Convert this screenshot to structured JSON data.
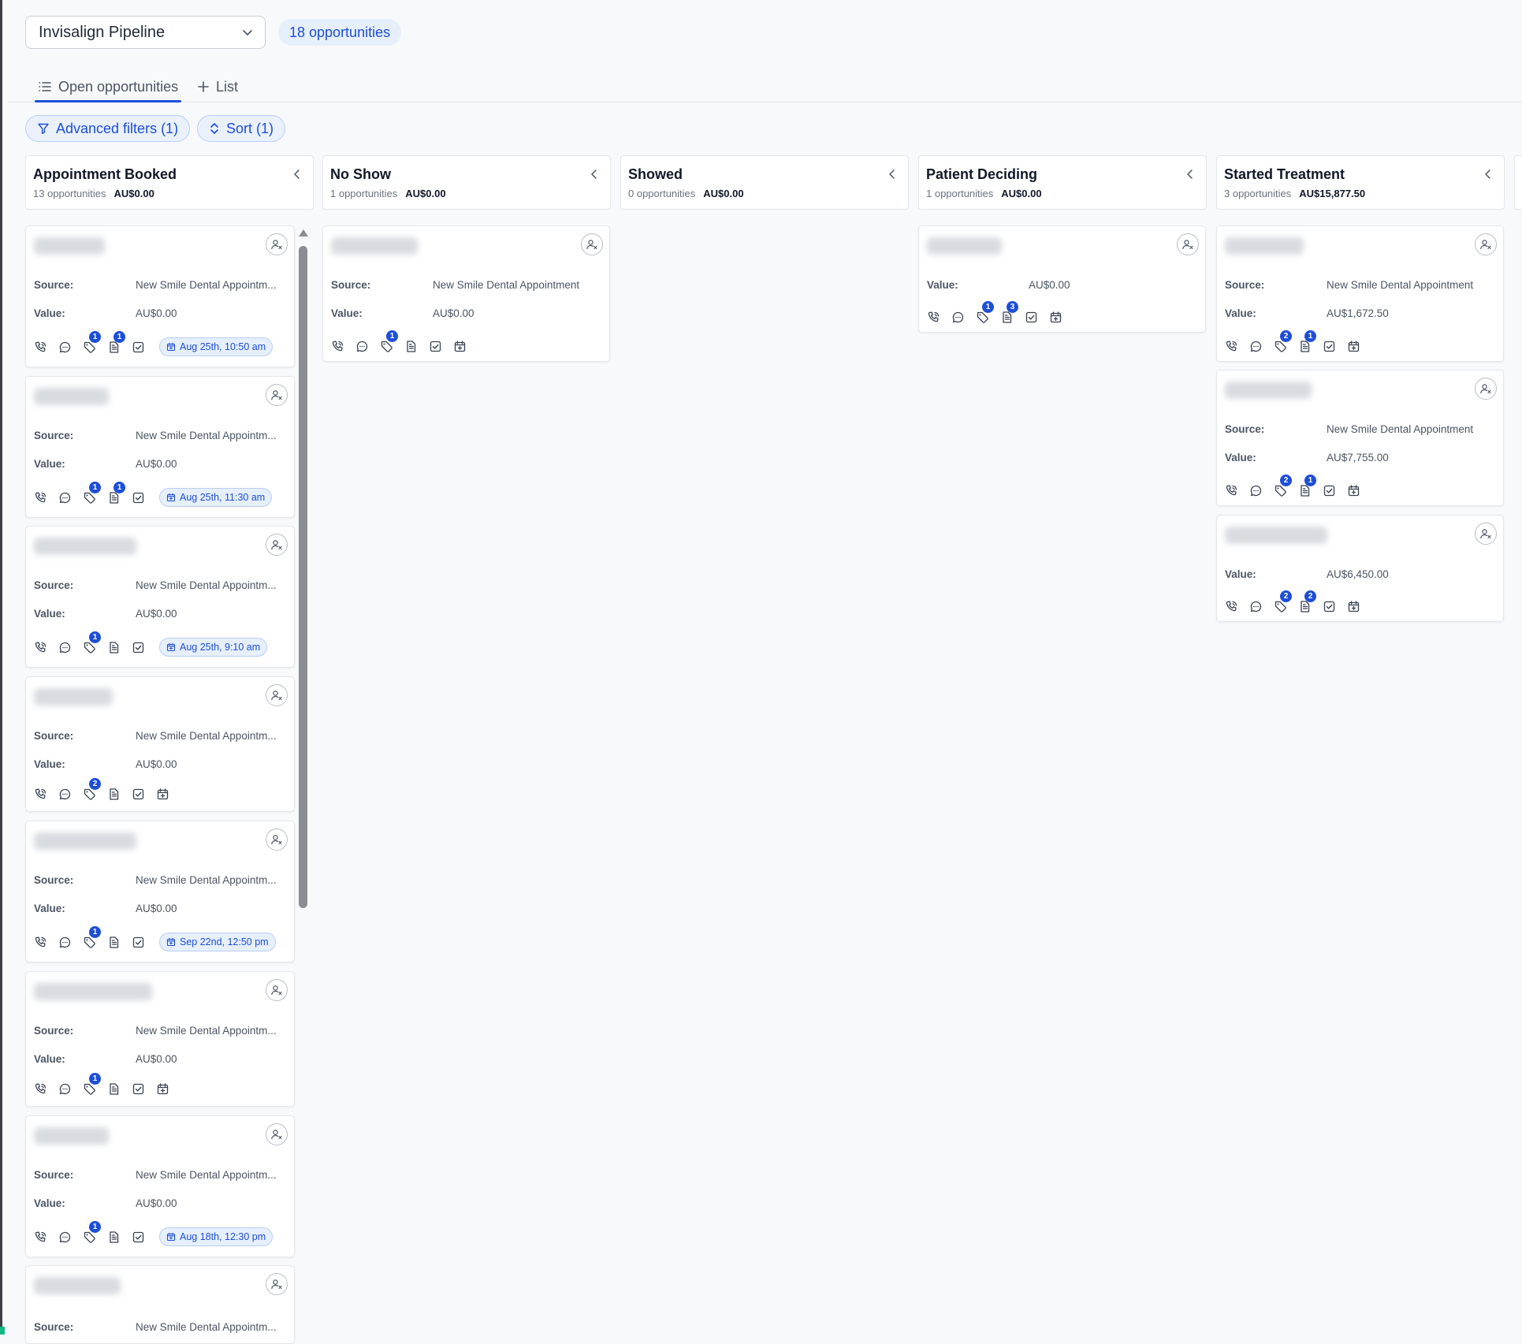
{
  "header": {
    "pipeline_label": "Invisalign Pipeline",
    "opportunity_count": "18 opportunities"
  },
  "tabs": {
    "open": "Open opportunities",
    "list": "List"
  },
  "filters": {
    "advanced": "Advanced filters (1)",
    "sort": "Sort (1)"
  },
  "columns": [
    {
      "title": "Appointment Booked",
      "count": "13 opportunities",
      "amount": "AU$0.00"
    },
    {
      "title": "No Show",
      "count": "1 opportunities",
      "amount": "AU$0.00"
    },
    {
      "title": "Showed",
      "count": "0 opportunities",
      "amount": "AU$0.00"
    },
    {
      "title": "Patient Deciding",
      "count": "1 opportunities",
      "amount": "AU$0.00"
    },
    {
      "title": "Started Treatment",
      "count": "3 opportunities",
      "amount": "AU$15,877.50"
    }
  ],
  "labels": {
    "source": "Source:",
    "value": "Value:"
  },
  "cards": {
    "booked": [
      {
        "source": "New Smile Dental Appointm...",
        "value": "AU$0.00",
        "badges": [
          "",
          "",
          "1",
          "1"
        ],
        "appointment": "Aug 25th, 10:50 am"
      },
      {
        "source": "New Smile Dental Appointm...",
        "value": "AU$0.00",
        "badges": [
          "",
          "",
          "1",
          "1"
        ],
        "appointment": "Aug 25th, 11:30 am"
      },
      {
        "source": "New Smile Dental Appointm...",
        "value": "AU$0.00",
        "badges": [
          "",
          "",
          "1",
          ""
        ],
        "appointment": "Aug 25th, 9:10 am"
      },
      {
        "source": "New Smile Dental Appointm...",
        "value": "AU$0.00",
        "badges": [
          "",
          "",
          "2",
          ""
        ],
        "appointment": ""
      },
      {
        "source": "New Smile Dental Appointm...",
        "value": "AU$0.00",
        "badges": [
          "",
          "",
          "1",
          ""
        ],
        "appointment": "Sep 22nd, 12:50 pm"
      },
      {
        "source": "New Smile Dental Appointm...",
        "value": "AU$0.00",
        "badges": [
          "",
          "",
          "1",
          ""
        ],
        "appointment": ""
      },
      {
        "source": "New Smile Dental Appointm...",
        "value": "AU$0.00",
        "badges": [
          "",
          "",
          "1",
          ""
        ],
        "appointment": "Aug 18th, 12:30 pm"
      },
      {
        "source": "New Smile Dental Appointm...",
        "value": "",
        "badges": [],
        "appointment": ""
      }
    ],
    "noshow": [
      {
        "source": "New Smile Dental Appointment",
        "value": "AU$0.00",
        "badges": [
          "",
          "",
          "1",
          ""
        ]
      }
    ],
    "deciding": [
      {
        "value": "AU$0.00",
        "badges": [
          "",
          "",
          "1",
          "3"
        ]
      }
    ],
    "started": [
      {
        "source": "New Smile Dental Appointment",
        "value": "AU$1,672.50",
        "badges": [
          "",
          "",
          "2",
          "1"
        ]
      },
      {
        "source": "New Smile Dental Appointment",
        "value": "AU$7,755.00",
        "badges": [
          "",
          "",
          "2",
          "1"
        ]
      },
      {
        "source": "",
        "value": "AU$6,450.00",
        "badges": [
          "",
          "",
          "2",
          "2"
        ]
      }
    ]
  },
  "icons": {
    "phone": "phone-icon",
    "chat": "chat-icon",
    "tag": "tag-icon",
    "note": "note-icon",
    "task": "task-icon",
    "calendar": "calendar-icon",
    "assign": "assign-user-icon",
    "collapse": "chevron-left-icon"
  },
  "colors": {
    "accent": "#1d4ed8",
    "badge_bg": "#e6effc"
  }
}
